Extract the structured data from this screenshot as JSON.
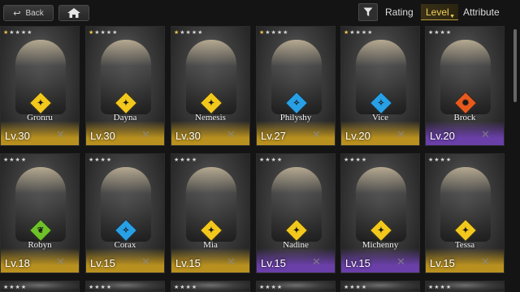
{
  "topbar": {
    "back_label": "Back",
    "back_icon": "return-arrow-icon",
    "home_icon": "home-icon",
    "filter_icon": "funnel-icon",
    "sort_rating": "Rating",
    "sort_level": "Level",
    "sort_attribute": "Attribute",
    "active_sort": "Level"
  },
  "colors": {
    "gold_rarity": "#b8901f",
    "purple_rarity": "#6a3fa8",
    "attr_yellow": "#f2c81c",
    "attr_blue": "#27a0e6",
    "attr_orange": "#e85a1c",
    "attr_green": "#6ec228"
  },
  "characters": [
    {
      "name": "Gronru",
      "level": "Lv.30",
      "stars_gold": "★",
      "stars_grey": "★★★★",
      "attribute": "yellow",
      "rarity": "gold"
    },
    {
      "name": "Dayna",
      "level": "Lv.30",
      "stars_gold": "★",
      "stars_grey": "★★★★",
      "attribute": "yellow",
      "rarity": "gold"
    },
    {
      "name": "Nemesis",
      "level": "Lv.30",
      "stars_gold": "★",
      "stars_grey": "★★★★",
      "attribute": "yellow",
      "rarity": "gold"
    },
    {
      "name": "Philyshy",
      "level": "Lv.27",
      "stars_gold": "★",
      "stars_grey": "★★★★",
      "attribute": "blue",
      "rarity": "gold"
    },
    {
      "name": "Vice",
      "level": "Lv.20",
      "stars_gold": "★",
      "stars_grey": "★★★★",
      "attribute": "blue",
      "rarity": "gold"
    },
    {
      "name": "Brock",
      "level": "Lv.20",
      "stars_gold": "",
      "stars_grey": "★★★★",
      "attribute": "orange",
      "rarity": "purple"
    },
    {
      "name": "Robyn",
      "level": "Lv.18",
      "stars_gold": "",
      "stars_grey": "★★★★",
      "attribute": "green",
      "rarity": "gold"
    },
    {
      "name": "Corax",
      "level": "Lv.15",
      "stars_gold": "",
      "stars_grey": "★★★★",
      "attribute": "blue",
      "rarity": "gold"
    },
    {
      "name": "Mia",
      "level": "Lv.15",
      "stars_gold": "",
      "stars_grey": "★★★★",
      "attribute": "yellow",
      "rarity": "gold"
    },
    {
      "name": "Nadine",
      "level": "Lv.15",
      "stars_gold": "",
      "stars_grey": "★★★★",
      "attribute": "yellow",
      "rarity": "purple"
    },
    {
      "name": "Michenny",
      "level": "Lv.15",
      "stars_gold": "",
      "stars_grey": "★★★★",
      "attribute": "yellow",
      "rarity": "purple"
    },
    {
      "name": "Tessa",
      "level": "Lv.15",
      "stars_gold": "",
      "stars_grey": "★★★★",
      "attribute": "yellow",
      "rarity": "gold"
    }
  ],
  "partial_row_stars": "★★★★"
}
